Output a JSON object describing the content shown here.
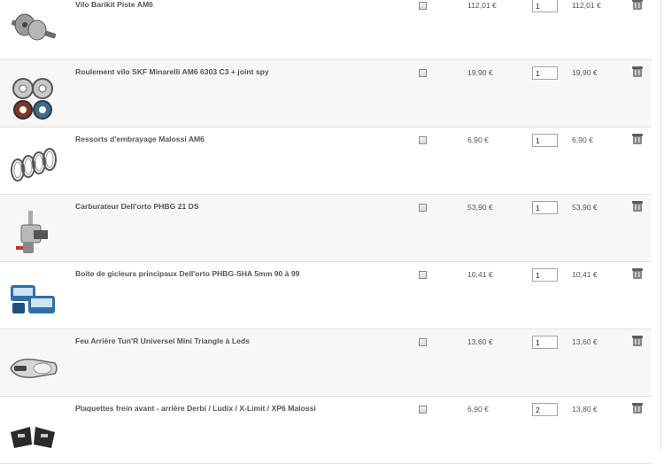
{
  "cart": {
    "items": [
      {
        "name": "Vilo Barikit Piste AM6",
        "price": "112,01 €",
        "qty": "1",
        "total": "112,01 €",
        "image": "crankshaft-image"
      },
      {
        "name": "Roulement vilo SKF Minarelli AM6 6303 C3 + joint spy",
        "price": "19,90 €",
        "qty": "1",
        "total": "19,90 €",
        "image": "bearings-image"
      },
      {
        "name": "Ressorts d'embrayage Malossi AM6",
        "price": "6,90 €",
        "qty": "1",
        "total": "6,90 €",
        "image": "springs-image"
      },
      {
        "name": "Carburateur Dell'orto PHBG 21 DS",
        "price": "53,90 €",
        "qty": "1",
        "total": "53,90 €",
        "image": "carburetor-image"
      },
      {
        "name": "Boite de gicleurs principaux Dell'orto PHBG-SHA 5mm 90 à 99",
        "price": "10,41 €",
        "qty": "1",
        "total": "10,41 €",
        "image": "jet-box-image"
      },
      {
        "name": "Feu Arrière Tun'R Universel Mini Triangle à Leds",
        "price": "13,60 €",
        "qty": "1",
        "total": "13,60 €",
        "image": "tail-light-image"
      },
      {
        "name": "Plaquettes frein avant - arrière Derbi / Ludix / X-Limit / XP6 Malossi",
        "price": "6,90 €",
        "qty": "2",
        "total": "13,80 €",
        "image": "brake-pads-image"
      }
    ]
  }
}
